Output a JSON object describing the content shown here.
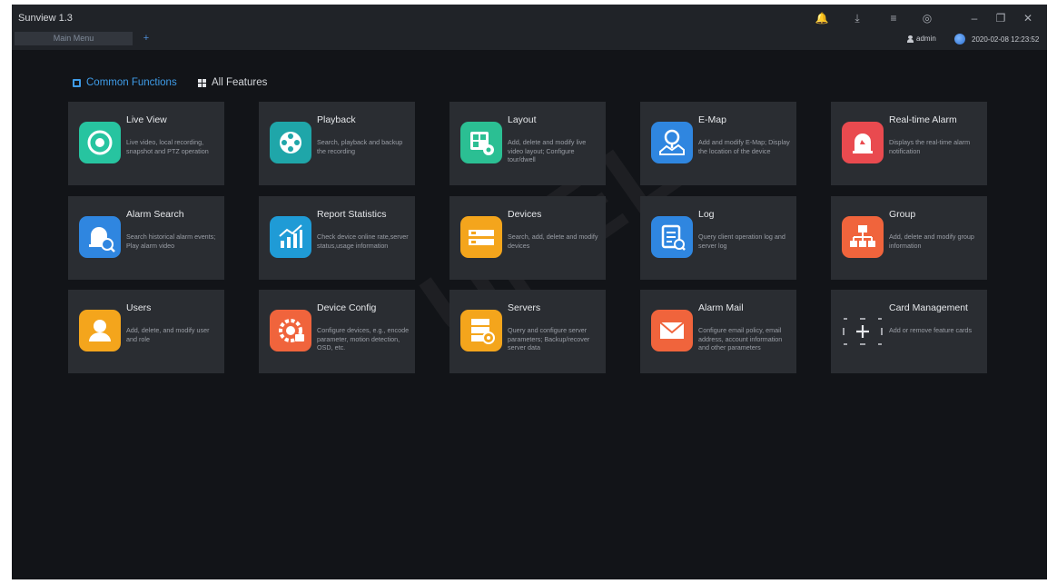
{
  "window": {
    "title": "Sunview 1.3",
    "tab_main": "Main Menu",
    "tab_add": "+",
    "controls": {
      "bell": "🔔",
      "download": "⤓",
      "menu": "≡",
      "settings": "◎",
      "minimize": "–",
      "restore": "❐",
      "close": "✕"
    }
  },
  "status": {
    "user": "admin",
    "datetime": "2020-02-08 12:23:52"
  },
  "feature_tabs": {
    "common": "Common Functions",
    "all": "All Features"
  },
  "watermark": "UNELL",
  "cards": [
    {
      "name": "Live View",
      "desc": "Live video, local recording, snapshot and PTZ operation",
      "icon": "live-view-icon",
      "color": "#27c4a0"
    },
    {
      "name": "Playback",
      "desc": "Search, playback and backup the recording",
      "icon": "playback-icon",
      "color": "#1fa6a9"
    },
    {
      "name": "Layout",
      "desc": "Add, delete and modify live video layout; Configure tour/dwell",
      "icon": "layout-icon",
      "color": "#2bbf93"
    },
    {
      "name": "E-Map",
      "desc": "Add and modify E-Map; Display the location of the device",
      "icon": "map-icon",
      "color": "#2f86e0"
    },
    {
      "name": "Real-time Alarm",
      "desc": "Displays the real-time alarm notification",
      "icon": "alarm-icon",
      "color": "#e94a4f"
    },
    {
      "name": "Alarm Search",
      "desc": "Search historical alarm events; Play alarm video",
      "icon": "alarm-search-icon",
      "color": "#2f86e0"
    },
    {
      "name": "Report Statistics",
      "desc": "Check device online rate,server status,usage information",
      "icon": "statistics-icon",
      "color": "#1f9bd6"
    },
    {
      "name": "Devices",
      "desc": "Search, add, delete and modify devices",
      "icon": "devices-icon",
      "color": "#f4a51c"
    },
    {
      "name": "Log",
      "desc": "Query client operation log and server log",
      "icon": "log-icon",
      "color": "#2f86e0"
    },
    {
      "name": "Group",
      "desc": "Add, delete and modify group information",
      "icon": "group-icon",
      "color": "#f0643c"
    },
    {
      "name": "Users",
      "desc": "Add, delete, and modify user and role",
      "icon": "user-icon",
      "color": "#f4a51c"
    },
    {
      "name": "Device Config",
      "desc": "Configure devices, e.g., encode parameter, motion detection, OSD, etc.",
      "icon": "device-config-icon",
      "color": "#f0643c"
    },
    {
      "name": "Servers",
      "desc": "Query and configure server parameters; Backup/recover server data",
      "icon": "servers-icon",
      "color": "#f4a51c"
    },
    {
      "name": "Alarm Mail",
      "desc": "Configure email policy, email address, account information and other parameters",
      "icon": "mail-icon",
      "color": "#f0643c"
    },
    {
      "name": "Card Management",
      "desc": "Add or remove feature cards",
      "icon": "add-card-icon",
      "color": "#2a2d32"
    }
  ]
}
